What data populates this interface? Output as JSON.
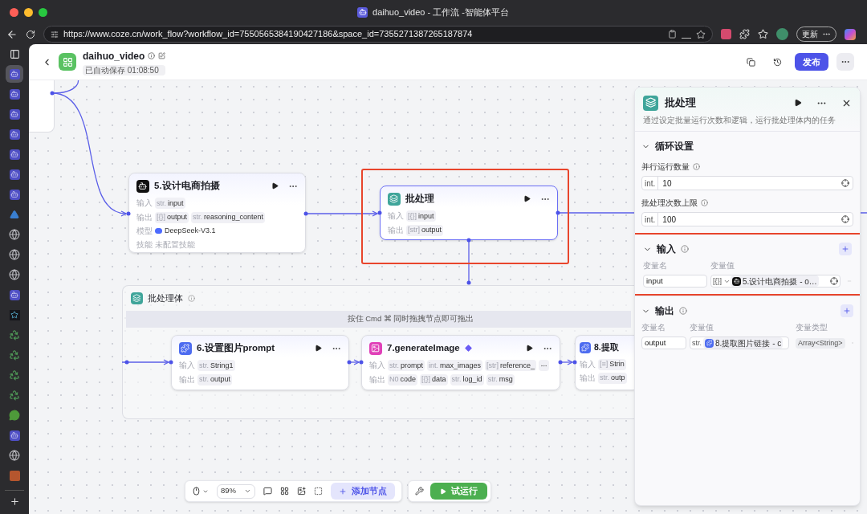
{
  "window": {
    "title": "daihuo_video - 工作流 -智能体平台"
  },
  "browser": {
    "url": "https://www.coze.cn/work_flow?workflow_id=7550565384190427186&space_id=7355271387265187874",
    "update_button": "更新"
  },
  "vertical_tabs": [
    {
      "kind": "coze",
      "selected": true
    },
    {
      "kind": "coze",
      "selected": false
    },
    {
      "kind": "coze",
      "selected": false
    },
    {
      "kind": "coze",
      "selected": false
    },
    {
      "kind": "coze",
      "selected": false
    },
    {
      "kind": "coze",
      "selected": false
    },
    {
      "kind": "coze",
      "selected": false
    },
    {
      "kind": "pyramid",
      "selected": false
    },
    {
      "kind": "globe",
      "selected": false
    },
    {
      "kind": "globe",
      "selected": false
    },
    {
      "kind": "globe",
      "selected": false
    },
    {
      "kind": "coze",
      "selected": false
    },
    {
      "kind": "star",
      "selected": false
    },
    {
      "kind": "recycle",
      "selected": false
    },
    {
      "kind": "recycle",
      "selected": false
    },
    {
      "kind": "recycle",
      "selected": false
    },
    {
      "kind": "recycle",
      "selected": false
    },
    {
      "kind": "chat",
      "selected": false
    },
    {
      "kind": "coze",
      "selected": false
    },
    {
      "kind": "globe",
      "selected": false
    },
    {
      "kind": "brick",
      "selected": false
    }
  ],
  "header": {
    "workflow_name": "daihuo_video",
    "autosave": "已自动保存 01:08:50",
    "publish_button": "发布"
  },
  "canvas": {
    "nodes": [
      {
        "kind": "llm",
        "title": "5.设计电商拍摄",
        "selected": false,
        "highlighted": false,
        "premium": false,
        "rows": [
          {
            "kind": "ports",
            "label": "输入",
            "overflow": false,
            "ports": [
              {
                "type": "str.",
                "name": "input"
              }
            ]
          },
          {
            "kind": "ports",
            "label": "输出",
            "overflow": false,
            "ports": [
              {
                "type": "[{}]",
                "name": "output"
              },
              {
                "type": "str.",
                "name": "reasoning_content"
              }
            ]
          },
          {
            "kind": "model",
            "label": "模型",
            "value": "DeepSeek-V3.1"
          },
          {
            "kind": "text",
            "label": "技能",
            "value": "未配置技能"
          }
        ]
      },
      {
        "kind": "batch",
        "title": "批处理",
        "selected": true,
        "highlighted": true,
        "premium": false,
        "rows": [
          {
            "kind": "ports",
            "label": "输入",
            "overflow": false,
            "ports": [
              {
                "type": "[{}]",
                "name": "input"
              }
            ]
          },
          {
            "kind": "ports",
            "label": "输出",
            "overflow": false,
            "ports": [
              {
                "type": "[str]",
                "name": "output"
              }
            ]
          }
        ]
      }
    ],
    "batch_body": {
      "title": "批处理体",
      "hint": "按住 Cmd ⌘ 同时拖拽节点即可拖出",
      "nodes": [
        {
          "kind": "code",
          "title": "6.设置图片prompt",
          "selected": false,
          "highlighted": false,
          "premium": false,
          "rows": [
            {
              "kind": "ports",
              "label": "输入",
              "overflow": false,
              "ports": [
                {
                  "type": "str.",
                  "name": "String1"
                }
              ]
            },
            {
              "kind": "ports",
              "label": "输出",
              "overflow": false,
              "ports": [
                {
                  "type": "str.",
                  "name": "output"
                }
              ]
            }
          ]
        },
        {
          "kind": "image",
          "title": "7.generateImage",
          "selected": false,
          "highlighted": false,
          "premium": true,
          "rows": [
            {
              "kind": "ports",
              "label": "输入",
              "overflow": true,
              "ports": [
                {
                  "type": "str.",
                  "name": "prompt"
                },
                {
                  "type": "int.",
                  "name": "max_images"
                },
                {
                  "type": "[str]",
                  "name": "reference_"
                }
              ]
            },
            {
              "kind": "ports",
              "label": "输出",
              "overflow": false,
              "ports": [
                {
                  "type": "N0",
                  "name": "code"
                },
                {
                  "type": "[{}]",
                  "name": "data"
                },
                {
                  "type": "str.",
                  "name": "log_id"
                },
                {
                  "type": "str.",
                  "name": "msg"
                }
              ]
            }
          ]
        },
        {
          "kind": "code",
          "title": "8.提取",
          "selected": false,
          "highlighted": false,
          "premium": false,
          "rows": [
            {
              "kind": "ports",
              "label": "输入",
              "overflow": false,
              "ports": [
                {
                  "type": "[≡]",
                  "name": "Strin"
                }
              ]
            },
            {
              "kind": "ports",
              "label": "输出",
              "overflow": false,
              "ports": [
                {
                  "type": "str.",
                  "name": "outp"
                }
              ]
            }
          ]
        }
      ]
    }
  },
  "panel": {
    "title": "批处理",
    "description": "通过设定批量运行次数和逻辑，运行批处理体内的任务",
    "sections": [
      {
        "kind": "settings",
        "title": "循环设置",
        "expanded": true,
        "highlighted": false,
        "fields": [
          {
            "label": "并行运行数量",
            "type": "int.",
            "value": "10"
          },
          {
            "label": "批处理次数上限",
            "type": "int.",
            "value": "100"
          }
        ]
      },
      {
        "kind": "inputs",
        "title": "输入",
        "expanded": true,
        "highlighted": true,
        "columns": [
          "变量名",
          "变量值"
        ],
        "rows": [
          {
            "name": "input",
            "type": "[{}]",
            "ref": "5.设计电商拍摄 - o…"
          }
        ]
      },
      {
        "kind": "outputs",
        "title": "输出",
        "expanded": true,
        "highlighted": false,
        "columns": [
          "变量名",
          "变量值",
          "变量类型"
        ],
        "rows": [
          {
            "name": "output",
            "type": "str.",
            "ref": "8.提取图片链接 - c",
            "var_type": "Array<String>"
          }
        ]
      }
    ]
  },
  "toolbar": {
    "zoom": "89%",
    "add_node": "添加节点",
    "test_run": "试运行"
  }
}
